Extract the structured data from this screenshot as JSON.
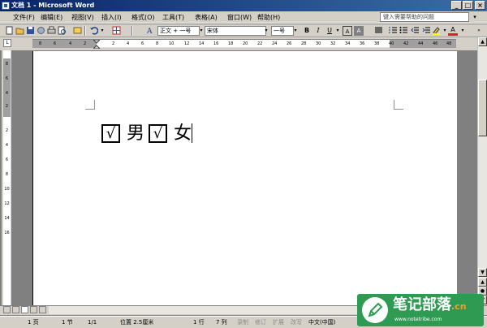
{
  "window": {
    "title": "文档 1 - Microsoft Word"
  },
  "menu": {
    "items": [
      "文件(F)",
      "编辑(E)",
      "视图(V)",
      "插入(I)",
      "格式(O)",
      "工具(T)",
      "表格(A)",
      "窗口(W)",
      "帮助(H)"
    ],
    "help_placeholder": "键入需要帮助的问题"
  },
  "toolbar": {
    "style_value": "正文 + 一号",
    "font_value": "宋体",
    "size_value": "一号",
    "bold": "B",
    "italic": "I",
    "underline": "U",
    "char_scale": "A",
    "font_color": "A"
  },
  "ruler": {
    "h_ticks": [
      "8",
      "6",
      "4",
      "2",
      "2",
      "4",
      "6",
      "8",
      "10",
      "12",
      "14",
      "16",
      "18",
      "20",
      "22",
      "24",
      "26",
      "28",
      "30",
      "32",
      "34",
      "36",
      "38",
      "40",
      "42",
      "44",
      "46",
      "48"
    ],
    "v_ticks": [
      "8",
      "6",
      "4",
      "2",
      "2",
      "4",
      "6",
      "8",
      "10",
      "12",
      "14",
      "16"
    ],
    "corner": "L"
  },
  "document": {
    "check1": "√",
    "label1": "男",
    "check2": "√",
    "label2": "女"
  },
  "status": {
    "page": "1 页",
    "section": "1 节",
    "page_of": "1/1",
    "position": "位置 2.5厘米",
    "line": "1 行",
    "column": "7 列",
    "rec": "录制",
    "trk": "修订",
    "ext": "扩展",
    "ovr": "改写",
    "language": "中文(中国)"
  },
  "watermark": {
    "text": "笔记部落",
    "suffix": ".cn",
    "url": "www.notetribe.com"
  },
  "colors": {
    "title_start": "#0a246a",
    "title_end": "#3a6ea5",
    "chrome": "#d4d0c8",
    "workspace": "#808080",
    "watermark_green": "#2f9a52"
  }
}
